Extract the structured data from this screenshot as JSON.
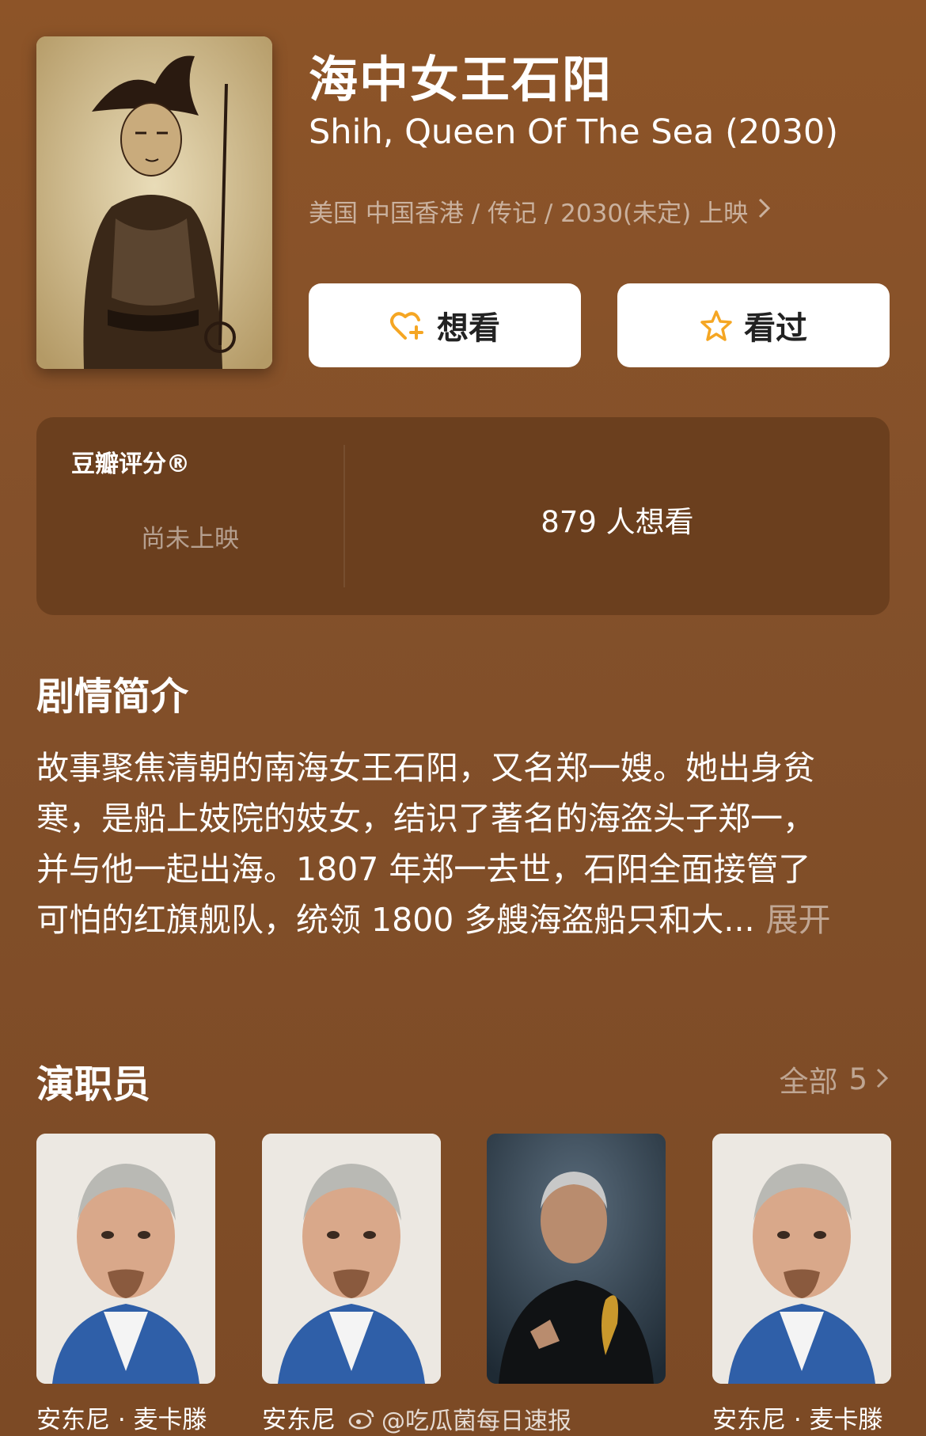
{
  "movie": {
    "title_cn": "海中女王石阳",
    "title_en": "Shih, Queen Of The Sea (2030)",
    "meta": "美国 中国香港 / 传记 / 2030(未定) 上映"
  },
  "actions": {
    "want_label": "想看",
    "seen_label": "看过"
  },
  "rating": {
    "label": "豆瓣评分®",
    "status": "尚未上映",
    "wish_count": "879 人想看"
  },
  "synopsis": {
    "title": "剧情简介",
    "lines": [
      "故事聚焦清朝的南海女王石阳，又名郑一嫂。她出身贫",
      "寒，是船上妓院的妓女，结识了著名的海盗头子郑一，",
      "并与他一起出海。1807 年郑一去世，石阳全面接管了",
      "可怕的红旗舰队，统领 1800 多艘海盗船只和大..."
    ],
    "expand_label": "展开"
  },
  "cast": {
    "title": "演职员",
    "all_label": "全部",
    "all_count": "5",
    "members": [
      {
        "name": "安东尼 · 麦卡滕"
      },
      {
        "name": "安东尼"
      },
      {
        "name": ""
      },
      {
        "name": "安东尼 · 麦卡滕"
      }
    ]
  },
  "watermark": "@吃瓜菌每日速报",
  "colors": {
    "background": "#8d5428",
    "card": "#6b3f1e",
    "accent_orange": "#f5a623"
  }
}
